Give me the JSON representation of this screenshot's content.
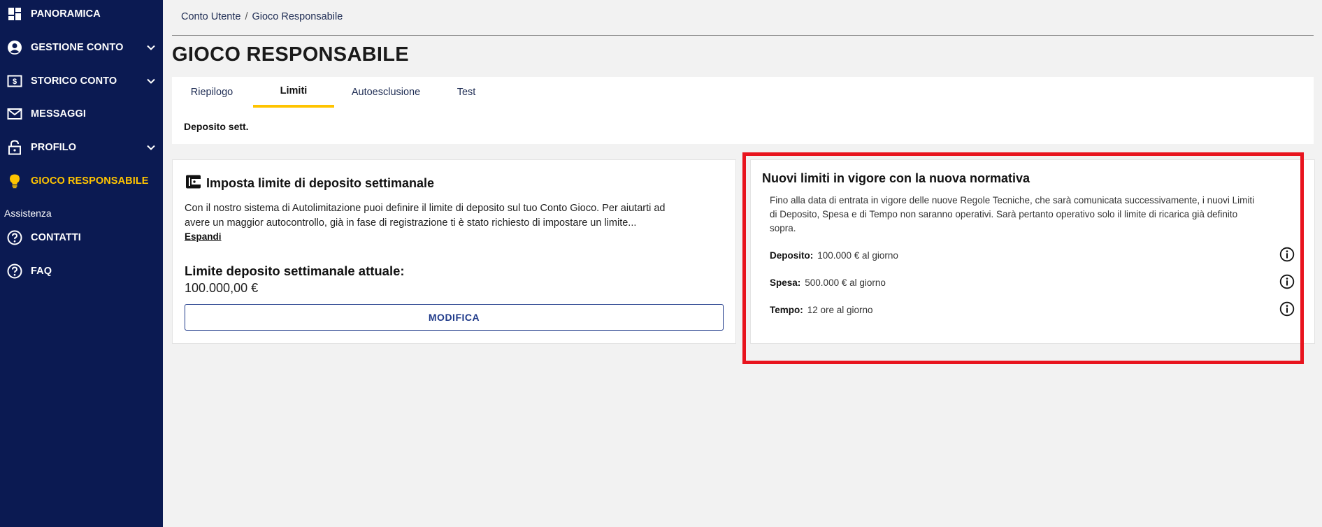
{
  "sidebar": {
    "items": [
      {
        "label": "PANORAMICA",
        "icon": "dashboard-icon",
        "chevron": false,
        "active": false
      },
      {
        "label": "GESTIONE CONTO",
        "icon": "user-circle-icon",
        "chevron": true,
        "active": false
      },
      {
        "label": "STORICO CONTO",
        "icon": "money-icon",
        "chevron": true,
        "active": false
      },
      {
        "label": "MESSAGGI",
        "icon": "mail-icon",
        "chevron": false,
        "active": false
      },
      {
        "label": "PROFILO",
        "icon": "lock-icon",
        "chevron": true,
        "active": false
      },
      {
        "label": "GIOCO RESPONSABILE",
        "icon": "lightbulb-icon",
        "chevron": false,
        "active": true
      }
    ],
    "section_label": "Assistenza",
    "support_items": [
      {
        "label": "CONTATTI",
        "icon": "help-circle-icon"
      },
      {
        "label": "FAQ",
        "icon": "help-circle-icon"
      }
    ]
  },
  "breadcrumb": {
    "items": [
      "Conto Utente",
      "Gioco Responsabile"
    ],
    "separator": "/"
  },
  "page": {
    "title": "GIOCO RESPONSABILE"
  },
  "tabs": {
    "items": [
      {
        "label": "Riepilogo",
        "active": false
      },
      {
        "label": "Limiti",
        "active": true
      },
      {
        "label": "Autoesclusione",
        "active": false
      },
      {
        "label": "Test",
        "active": false
      }
    ],
    "sub_label": "Deposito sett."
  },
  "deposit_card": {
    "title": "Imposta limite di deposito settimanale",
    "description_line1": "Con il nostro sistema di Autolimitazione puoi definire il limite di deposito sul tuo Conto Gioco. Per aiutarti ad",
    "description_line2": "avere un maggior autocontrollo, già in fase di registrazione ti è stato richiesto di impostare un limite...",
    "expand_label": "Espandi",
    "limit_label": "Limite deposito settimanale attuale:",
    "limit_value": "100.000,00 €",
    "modify_button": "MODIFICA"
  },
  "regulation_card": {
    "title": "Nuovi limiti in vigore con la nuova normativa",
    "description_line1": "Fino alla data di entrata in vigore delle nuove Regole Tecniche, che sarà comunicata successivamente, i nuovi Limiti",
    "description_line2": "di Deposito, Spesa e di Tempo non saranno operativi. Sarà pertanto operativo solo il limite di ricarica già definito",
    "description_line3": "sopra.",
    "rules": [
      {
        "key": "Deposito:",
        "value": "100.000 € al giorno"
      },
      {
        "key": "Spesa:",
        "value": "500.000 € al giorno"
      },
      {
        "key": "Tempo:",
        "value": "12 ore al giorno"
      }
    ]
  },
  "colors": {
    "sidebar_bg": "#0b1a52",
    "accent": "#ffc400",
    "primary": "#1f3a8a",
    "highlight": "#e8141e"
  }
}
